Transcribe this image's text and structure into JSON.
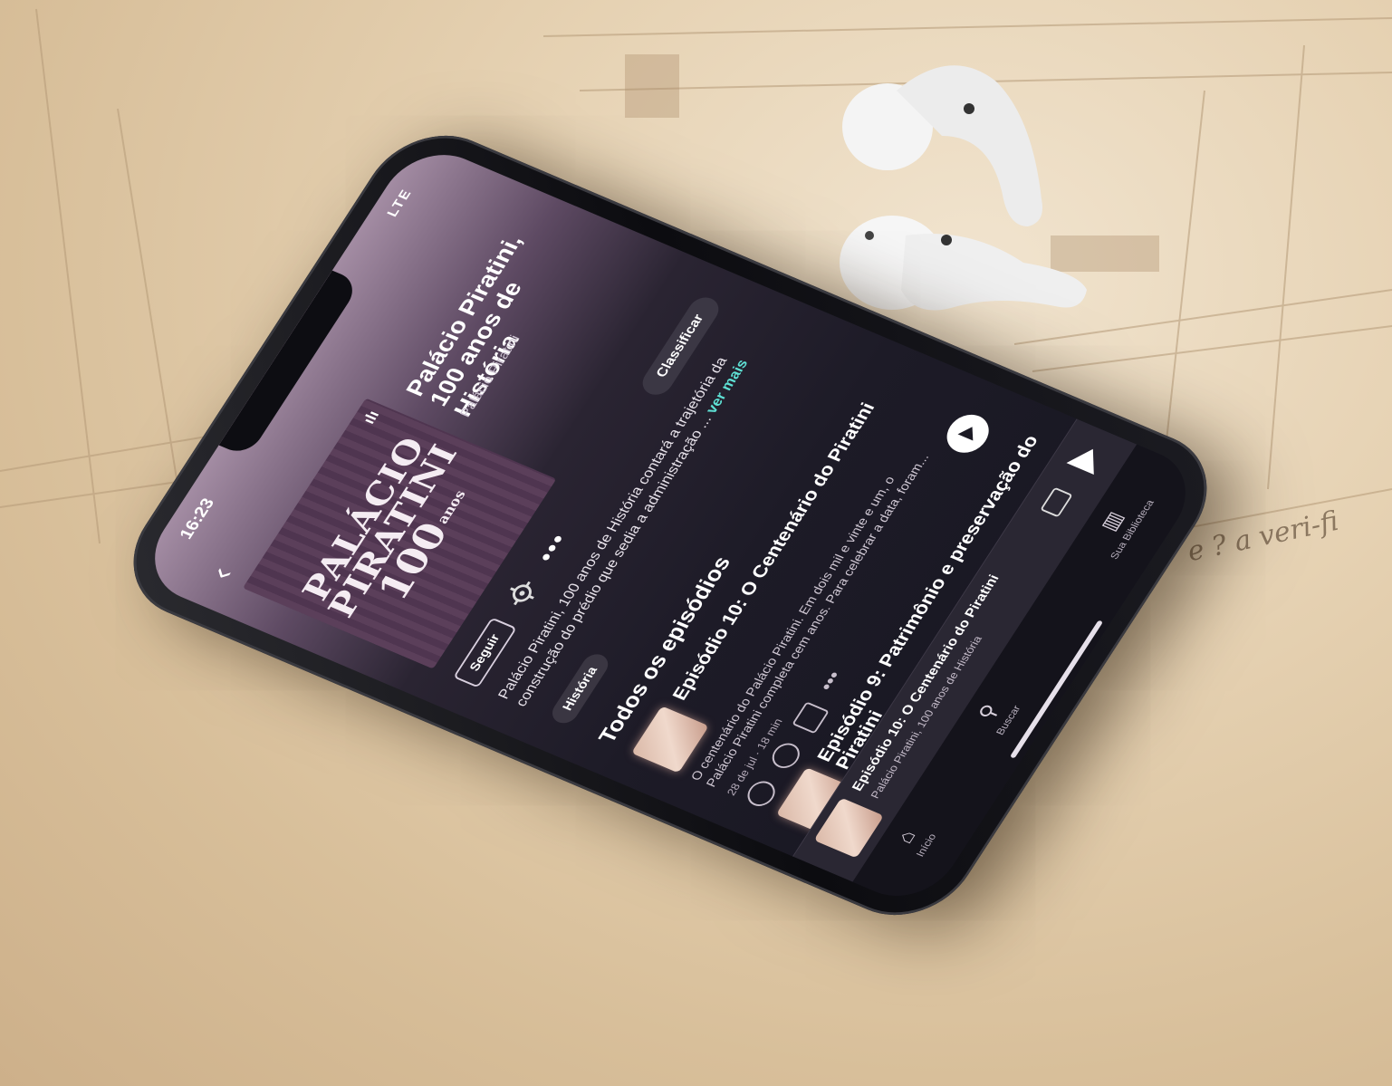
{
  "status_bar": {
    "time": "16:23",
    "right": "LTE"
  },
  "header": {
    "back_label": "‹"
  },
  "podcast": {
    "cover": {
      "logo": "ılı",
      "line1": "PALÁCIO",
      "line2": "PIRATINI",
      "line3": "100",
      "anos": "anos"
    },
    "title": "Palácio Piratini, 100 anos de História",
    "author": "Palácio Piratini",
    "follow_label": "Seguir",
    "more_label": "•••",
    "classify_label": "Classificar",
    "description": "Palácio Piratini, 100 anos de História contará a trajetória da construção do prédio que sedia a administração ...",
    "see_more": "ver mais",
    "category_chip": "História"
  },
  "episodes_section": {
    "title": "Todos os episódios",
    "episodes": [
      {
        "title": "Episódio 10: O Centenário do Piratini",
        "description": "O centenário do Palácio Piratini. Em dois mil e vinte e um, o Palácio Piratini completa cem anos. Para celebrar a data, foram...",
        "meta": "28 de jul · 18 min",
        "more": "•••"
      },
      {
        "title": "Episódio 9: Patrimônio e preservação do Piratini",
        "description": "",
        "meta": "",
        "more": ""
      }
    ]
  },
  "mini_player": {
    "title": "Episódio 10: O Centenário do Piratini",
    "subtitle": "Palácio Piratini, 100 anos de História"
  },
  "bottom_nav": {
    "home": "Início",
    "search": "Buscar",
    "library": "Sua Biblioteca"
  },
  "background": {
    "handwriting": "e ? a veri-fi"
  },
  "colors": {
    "accent": "#5ee0d4",
    "screen_bg": "#1d1b27",
    "paper": "#e2cba8"
  },
  "icons": {
    "gear": "gear-icon",
    "download": "download-icon",
    "share": "share-icon",
    "devices": "devices-icon",
    "play": "play-icon"
  }
}
